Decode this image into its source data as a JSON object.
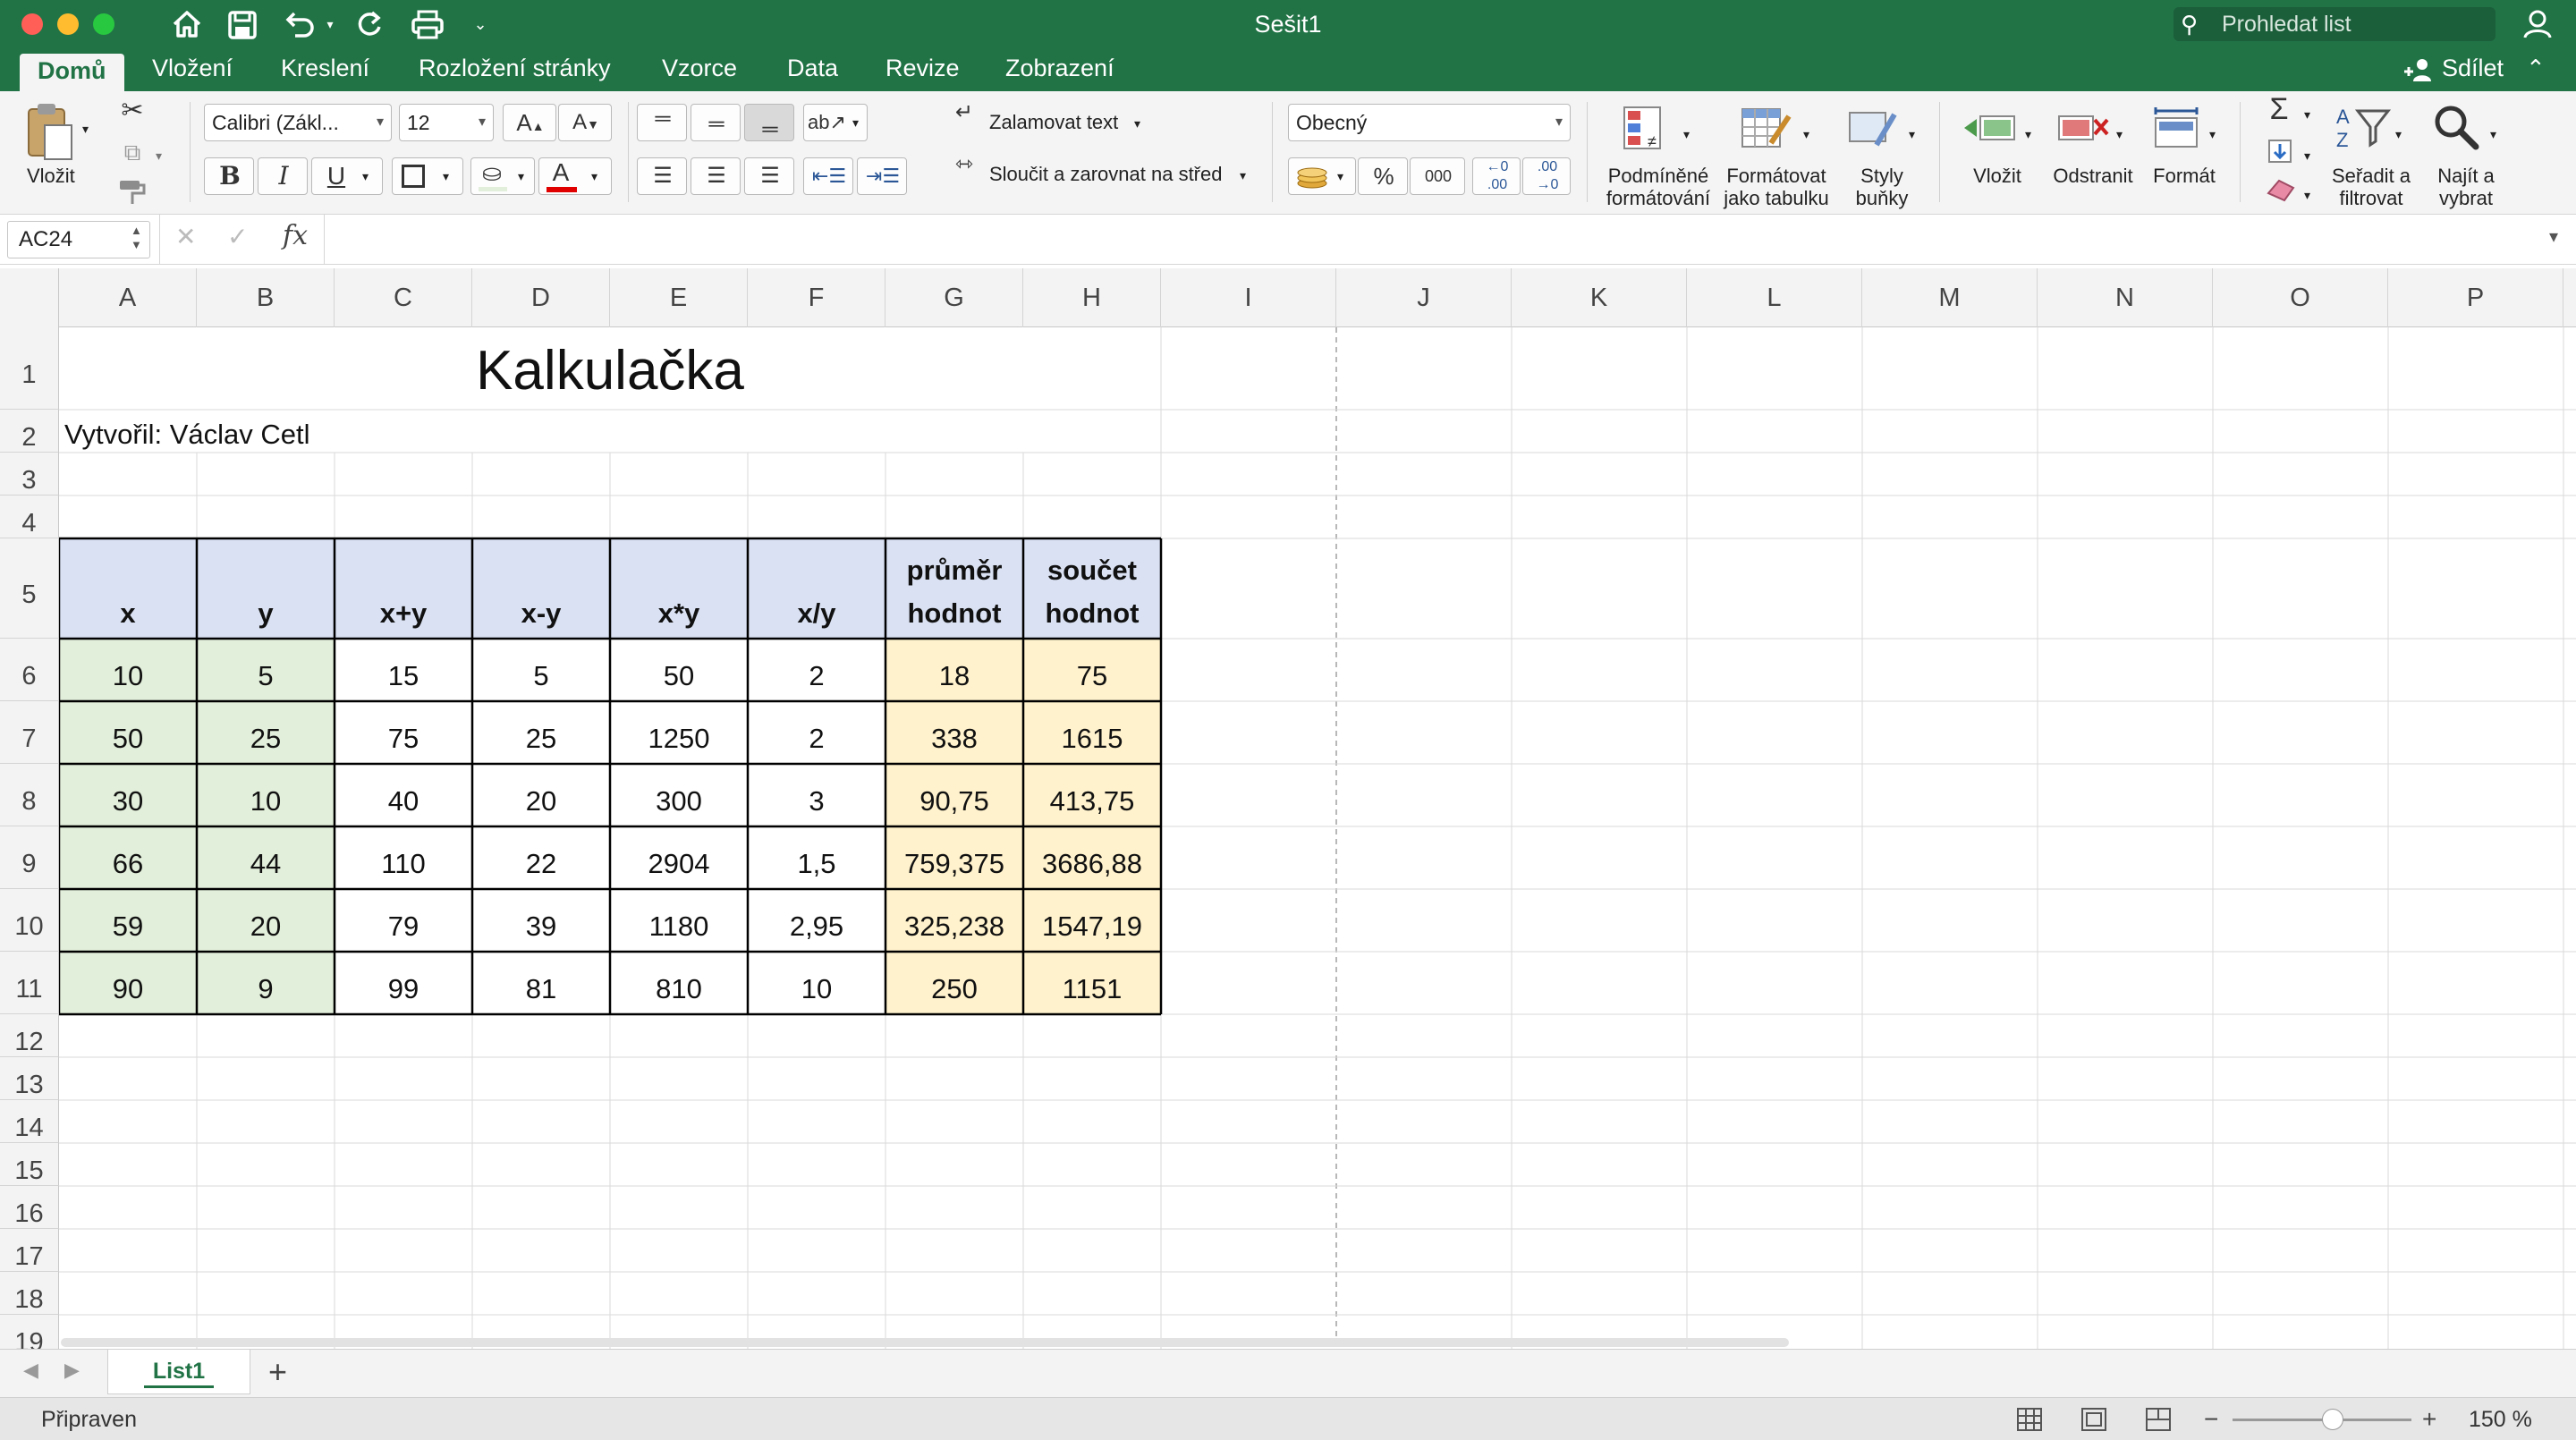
{
  "window": {
    "title": "Sešit1",
    "search_placeholder": "Prohledat list"
  },
  "tabs": [
    "Domů",
    "Vložení",
    "Kreslení",
    "Rozložení stránky",
    "Vzorce",
    "Data",
    "Revize",
    "Zobrazení"
  ],
  "share_label": "Sdílet",
  "ribbon": {
    "paste_label": "Vložit",
    "font_name": "Calibri (Zákl...",
    "font_size": "12",
    "wrap_text": "Zalamovat text",
    "merge_center": "Sloučit a zarovnat na střed",
    "number_format": "Obecný",
    "percent": "%",
    "thousands": "000",
    "cond_format_1": "Podmíněné",
    "cond_format_2": "formátování",
    "format_table_1": "Formátovat",
    "format_table_2": "jako tabulku",
    "cell_styles_1": "Styly",
    "cell_styles_2": "buňky",
    "insert": "Vložit",
    "delete": "Odstranit",
    "format": "Formát",
    "sort_1": "Seřadit a",
    "sort_2": "filtrovat",
    "find_1": "Najít a",
    "find_2": "vybrat"
  },
  "formula_bar": {
    "name_box": "AC24",
    "fx": "fx",
    "content": ""
  },
  "columns": [
    "A",
    "B",
    "C",
    "D",
    "E",
    "F",
    "G",
    "H",
    "I",
    "J",
    "K",
    "L",
    "M",
    "N",
    "O",
    "P"
  ],
  "rows": [
    "1",
    "2",
    "3",
    "4",
    "5",
    "6",
    "7",
    "8",
    "9",
    "10",
    "11",
    "12",
    "13",
    "14",
    "15",
    "16",
    "17",
    "18",
    "19"
  ],
  "sheet": {
    "title": "Kalkulačka",
    "author": "Vytvořil: Václav Cetl",
    "headers": [
      "x",
      "y",
      "x+y",
      "x-y",
      "x*y",
      "x/y",
      "průměr hodnot",
      "součet hodnot"
    ],
    "headers_line1": [
      "",
      "",
      "",
      "",
      "",
      "",
      "průměr",
      "součet"
    ],
    "headers_line2": [
      "x",
      "y",
      "x+y",
      "x-y",
      "x*y",
      "x/y",
      "hodnot",
      "hodnot"
    ],
    "data": [
      [
        "10",
        "5",
        "15",
        "5",
        "50",
        "2",
        "18",
        "75"
      ],
      [
        "50",
        "25",
        "75",
        "25",
        "1250",
        "2",
        "338",
        "1615"
      ],
      [
        "30",
        "10",
        "40",
        "20",
        "300",
        "3",
        "90,75",
        "413,75"
      ],
      [
        "66",
        "44",
        "110",
        "22",
        "2904",
        "1,5",
        "759,375",
        "3686,88"
      ],
      [
        "59",
        "20",
        "79",
        "39",
        "1180",
        "2,95",
        "325,238",
        "1547,19"
      ],
      [
        "90",
        "9",
        "99",
        "81",
        "810",
        "10",
        "250",
        "1151"
      ]
    ]
  },
  "sheet_tabs": [
    "List1"
  ],
  "status": {
    "text": "Připraven",
    "zoom": "150 %"
  },
  "colors": {
    "brand": "#217346",
    "header_fill": "#d9e1f2",
    "xy_fill": "#e2efda",
    "result_fill": "#fff2cc"
  }
}
